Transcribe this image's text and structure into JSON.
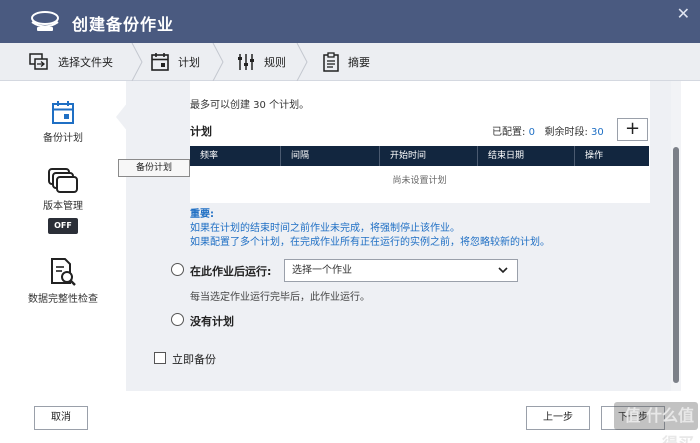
{
  "window": {
    "title": "创建备份作业",
    "close_glyph": "✕",
    "logo_icon": "backup-logo-icon"
  },
  "steps": [
    {
      "label": "选择文件夹",
      "icon": "folder-copy-icon"
    },
    {
      "label": "计划",
      "icon": "calendar-icon"
    },
    {
      "label": "规则",
      "icon": "sliders-icon"
    },
    {
      "label": "摘要",
      "icon": "clipboard-icon"
    }
  ],
  "sidebar": {
    "items": [
      {
        "label": "备份计划",
        "icon": "calendar-icon",
        "active": true
      },
      {
        "label": "版本管理",
        "icon": "versions-icon",
        "badge": "OFF"
      },
      {
        "label": "数据完整性检查",
        "icon": "document-search-icon"
      }
    ],
    "tooltip": "备份计划"
  },
  "schedule": {
    "limit_text": "最多可以创建 30 个计划。",
    "section_title": "计划",
    "configured_label": "已配置:",
    "configured_value": "0",
    "remaining_label": "剩余时段:",
    "remaining_value": "30",
    "add_label": "+",
    "columns": [
      "频率",
      "间隔",
      "开始时间",
      "结束日期",
      "操作"
    ],
    "empty_text": "尚未设置计划",
    "important_title": "重要:",
    "notes": [
      "如果在计划的结束时间之前作业未完成，将强制停止该作业。",
      "如果配置了多个计划，在完成作业所有正在运行的实例之前，将忽略较新的计划。"
    ]
  },
  "options": {
    "after_job_label": "在此作业后运行:",
    "after_job_select": "选择一个作业",
    "after_job_hint": "每当选定作业运行完毕后，此作业运行。",
    "no_schedule_label": "没有计划",
    "backup_now_label": "立即备份"
  },
  "footer": {
    "cancel_label": "取消",
    "prev_label": "上一步",
    "next_label": "下一步",
    "watermark": "值 什么值得买"
  },
  "colors": {
    "title_bar": "#4a5a80",
    "accent": "#1f6fc4",
    "table_header": "#12263f"
  }
}
